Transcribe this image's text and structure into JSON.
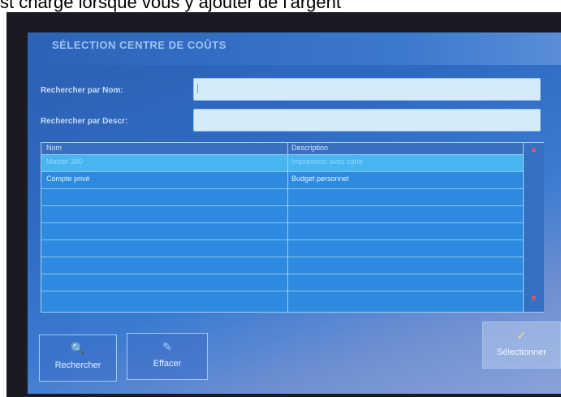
{
  "caption": "st chargé lorsque vous y ajouter de l'argent",
  "window": {
    "title": "SÉLECTION CENTRE DE COÛTS"
  },
  "search": {
    "name_label": "Rechercher par Nom:",
    "name_value": "",
    "descr_label": "Rechercher par Descr:",
    "descr_value": ""
  },
  "table": {
    "columns": [
      "Nom",
      "Description"
    ],
    "rows": [
      {
        "name": "Master 380",
        "description": "Impression avec carte",
        "selected": true
      },
      {
        "name": "Compte privé",
        "description": "Budget personnel",
        "selected": false
      }
    ]
  },
  "buttons": {
    "search": "Rechercher",
    "clear": "Effacer",
    "select": "Sélectionner"
  },
  "icons": [
    "search-icon",
    "eraser-icon",
    "select-icon",
    "scroll-up-icon",
    "scroll-down-icon"
  ]
}
